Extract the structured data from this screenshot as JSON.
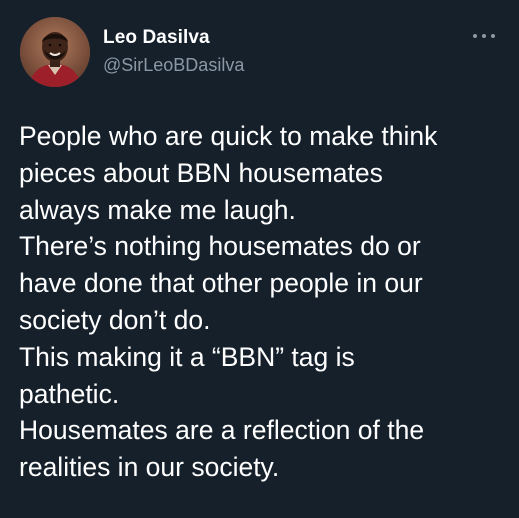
{
  "tweet": {
    "author_name": "Leo Dasilva",
    "author_handle": "@SirLeoBDasilva",
    "more_icon": "more-horizontal-icon",
    "lines": [
      "People who are quick to make think",
      "pieces about BBN housemates",
      "always make me laugh.",
      "There’s nothing housemates do or",
      "have done that other people in our",
      "society don’t do.",
      "This making it a “BBN” tag is",
      "pathetic.",
      "Housemates are a reflection of the",
      "realities in our society."
    ]
  },
  "colors": {
    "background": "#15202b",
    "text": "#ffffff",
    "secondary_text": "#8b98a5"
  }
}
